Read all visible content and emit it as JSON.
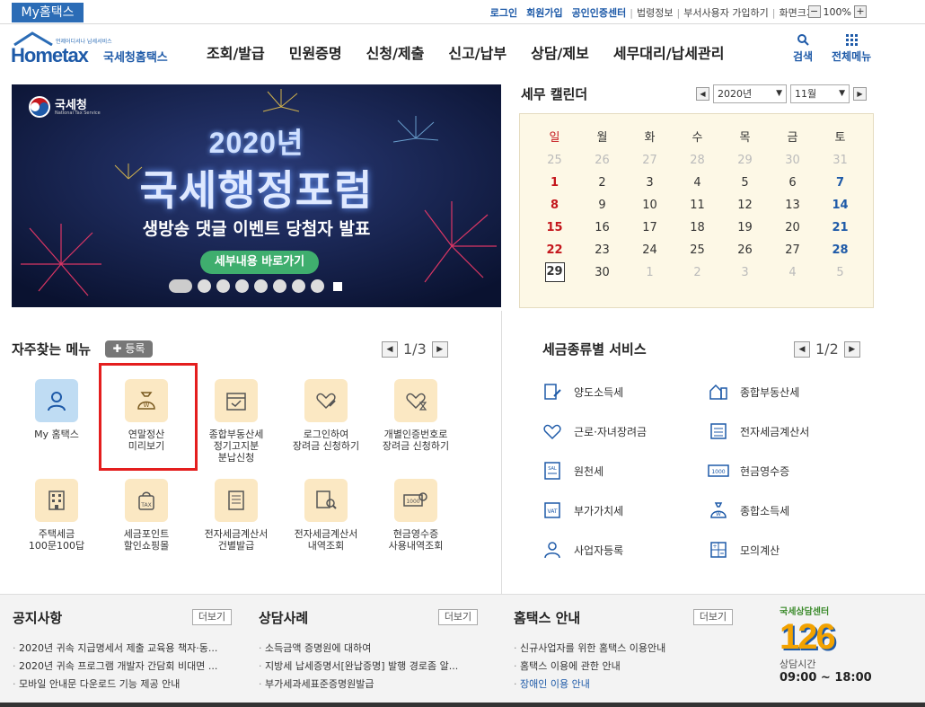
{
  "top": {
    "my_tab": "My홈택스",
    "links": [
      "로그인",
      "회원가입",
      "공인인증센터"
    ],
    "links2": [
      "법령정보",
      "부서사용자 가입하기",
      "화면크기"
    ],
    "zoom": "100%",
    "zoom_minus": "−",
    "zoom_plus": "+"
  },
  "header": {
    "logo_home": "Hometax",
    "logo_small": "언제어디서나 납세서비스",
    "logo_kor": "국세청홈택스",
    "nav": [
      "조회/발급",
      "민원증명",
      "신청/제출",
      "신고/납부",
      "상담/제보",
      "세무대리/납세관리"
    ],
    "search_label": "검색",
    "all_menu_label": "전체메뉴"
  },
  "banner": {
    "agency": "국세청",
    "agency_en": "National Tax Service",
    "year": "2020년",
    "title": "국세행정포럼",
    "subtitle": "생방송 댓글 이벤트 당첨자 발표",
    "button": "세부내용 바로가기"
  },
  "calendar": {
    "title": "세무 캘린더",
    "year": "2020년",
    "month": "11월",
    "weekdays": [
      "일",
      "월",
      "화",
      "수",
      "목",
      "금",
      "토"
    ],
    "weeks": [
      [
        "25",
        "26",
        "27",
        "28",
        "29",
        "30",
        "31"
      ],
      [
        "1",
        "2",
        "3",
        "4",
        "5",
        "6",
        "7"
      ],
      [
        "8",
        "9",
        "10",
        "11",
        "12",
        "13",
        "14"
      ],
      [
        "15",
        "16",
        "17",
        "18",
        "19",
        "20",
        "21"
      ],
      [
        "22",
        "23",
        "24",
        "25",
        "26",
        "27",
        "28"
      ],
      [
        "29",
        "30",
        "1",
        "2",
        "3",
        "4",
        "5"
      ]
    ]
  },
  "quick": {
    "title": "자주찾는 메뉴",
    "register": "등록",
    "page": "1/3",
    "items": [
      {
        "label": "My 홈택스",
        "icon": "person-icon"
      },
      {
        "label": "연말정산\n미리보기",
        "icon": "money-bag-icon"
      },
      {
        "label": "종합부동산세\n정기고지분\n분납신청",
        "icon": "calendar-check-icon"
      },
      {
        "label": "로그인하여\n장려금 신청하기",
        "icon": "heart-pen-icon"
      },
      {
        "label": "개별인증번호로\n장려금 신청하기",
        "icon": "heart-hourglass-icon"
      },
      {
        "label": "주택세금\n100문100답",
        "icon": "building-icon"
      },
      {
        "label": "세금포인트\n할인쇼핑몰",
        "icon": "tax-bag-icon"
      },
      {
        "label": "전자세금계산서\n건별발급",
        "icon": "invoice-icon"
      },
      {
        "label": "전자세금계산서\n내역조회",
        "icon": "invoice-search-icon"
      },
      {
        "label": "현금영수증\n사용내역조회",
        "icon": "receipt-search-icon"
      }
    ]
  },
  "tax_service": {
    "title": "세금종류별 서비스",
    "page": "1/2",
    "items": [
      {
        "label": "양도소득세",
        "icon": "document-pen-icon"
      },
      {
        "label": "종합부동산세",
        "icon": "house-building-icon"
      },
      {
        "label": "근로·자녀장려금",
        "icon": "heart-icon"
      },
      {
        "label": "전자세금계산서",
        "icon": "invoice-icon"
      },
      {
        "label": "원천세",
        "icon": "sal-document-icon"
      },
      {
        "label": "현금영수증",
        "icon": "cash-receipt-icon"
      },
      {
        "label": "부가가치세",
        "icon": "vat-icon"
      },
      {
        "label": "종합소득세",
        "icon": "won-bag-icon"
      },
      {
        "label": "사업자등록",
        "icon": "person-icon"
      },
      {
        "label": "모의계산",
        "icon": "calculator-icon"
      }
    ]
  },
  "footer": {
    "notice": {
      "title": "공지사항",
      "more": "더보기",
      "items": [
        "2020년 귀속 지급명세서 제출 교육용 책자·동...",
        "2020년 귀속 프로그램 개발자 간담회 비대면 ...",
        "모바일 안내문 다운로드 기능 제공 안내"
      ]
    },
    "consult": {
      "title": "상담사례",
      "more": "더보기",
      "items": [
        "소득금액 증명원에 대하여",
        "지방세 납세증명서[완납증명] 발행 경로좀 알...",
        "부가세과세표준증명원발급"
      ]
    },
    "hometax": {
      "title": "홈택스 안내",
      "more": "더보기",
      "items": [
        "신규사업자를 위한 홈택스 이용안내",
        "홈택스 이용에 관한 안내",
        "장애인 이용 안내"
      ]
    },
    "center": {
      "label": "국세상담센터",
      "number": "126",
      "hours_label": "상담시간",
      "hours": "09:00 ~ 18:00"
    }
  }
}
